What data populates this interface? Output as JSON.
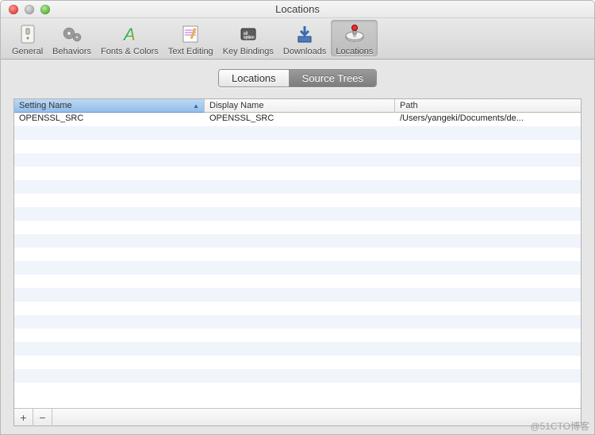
{
  "window": {
    "title": "Locations"
  },
  "toolbar": {
    "items": [
      {
        "label": "General"
      },
      {
        "label": "Behaviors"
      },
      {
        "label": "Fonts & Colors"
      },
      {
        "label": "Text Editing"
      },
      {
        "label": "Key Bindings"
      },
      {
        "label": "Downloads"
      },
      {
        "label": "Locations"
      }
    ]
  },
  "segmented": {
    "tabs": [
      {
        "label": "Locations"
      },
      {
        "label": "Source Trees"
      }
    ]
  },
  "table": {
    "columns": [
      {
        "label": "Setting Name"
      },
      {
        "label": "Display Name"
      },
      {
        "label": "Path"
      }
    ],
    "rows": [
      {
        "setting": "OPENSSL_SRC",
        "display": "OPENSSL_SRC",
        "path": "/Users/yangeki/Documents/de..."
      }
    ]
  },
  "footer": {
    "add": "+",
    "remove": "−"
  },
  "watermark": "@51CTO博客"
}
